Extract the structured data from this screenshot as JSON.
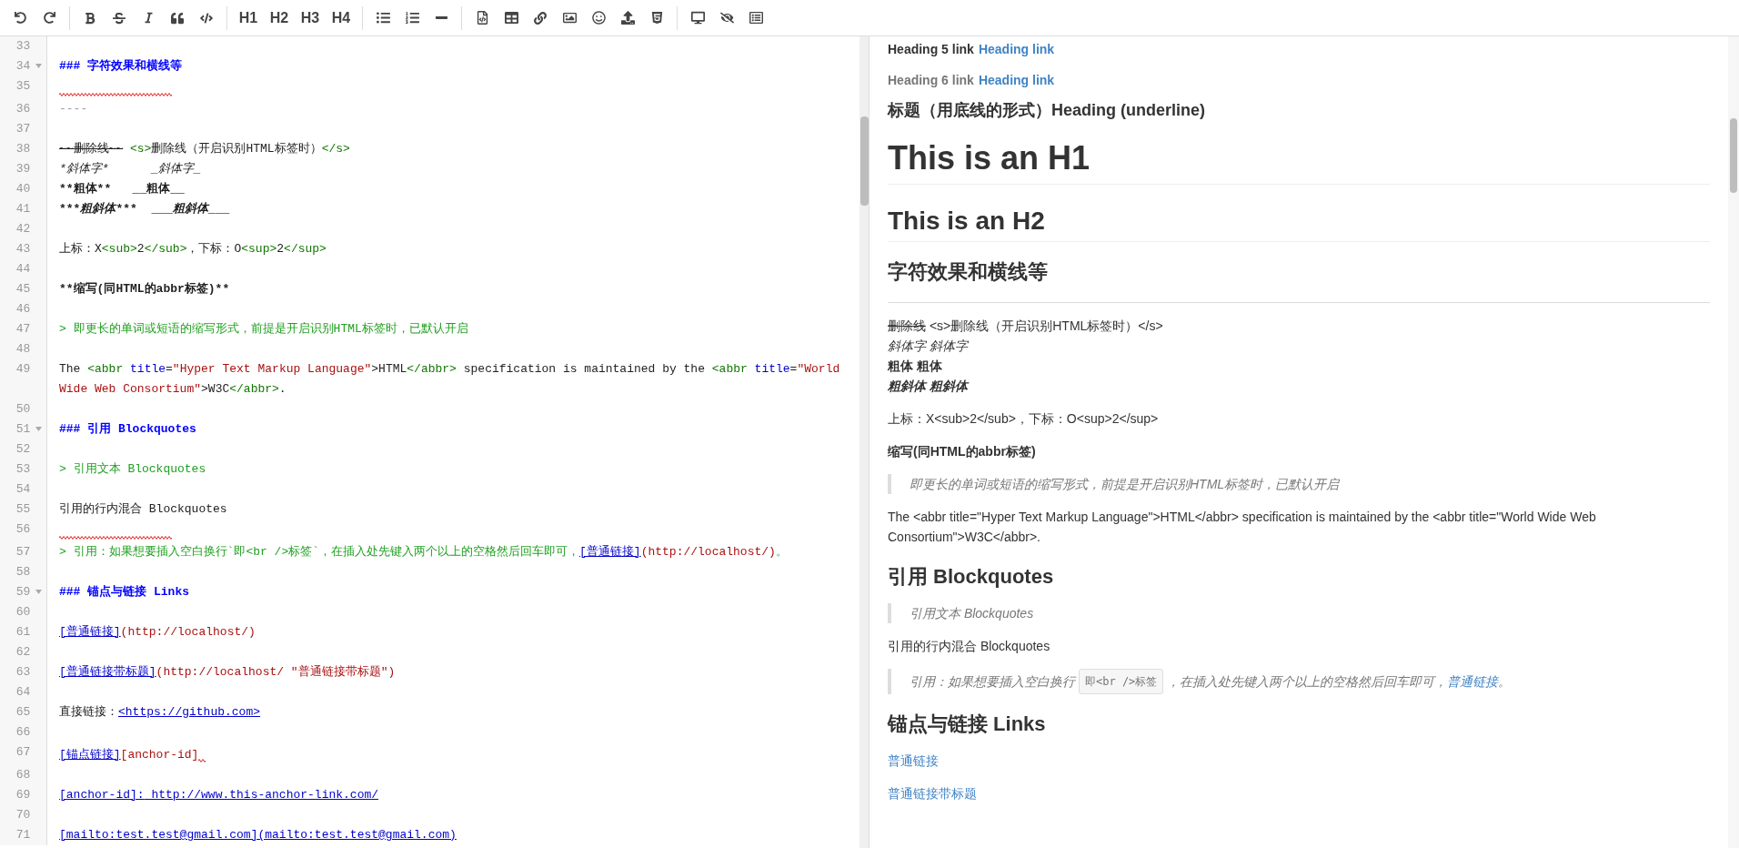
{
  "toolbar": {
    "headings": [
      "H1",
      "H2",
      "H3",
      "H4"
    ]
  },
  "editor": {
    "lines": [
      {
        "number": "33",
        "foldable": false,
        "squiggle": false
      },
      {
        "number": "34",
        "foldable": true,
        "squiggle": false,
        "segments": [
          {
            "text": "### 字符效果和横线等",
            "kind": "heading"
          }
        ]
      },
      {
        "number": "35",
        "foldable": false,
        "squiggle": true
      },
      {
        "number": "36",
        "foldable": false,
        "squiggle": false,
        "segments": [
          {
            "text": "----",
            "kind": "hr"
          }
        ]
      },
      {
        "number": "37",
        "foldable": false,
        "squiggle": false
      },
      {
        "number": "38",
        "foldable": false,
        "squiggle": false,
        "segments": [
          {
            "text": "~~删除线~~",
            "kind": "strike"
          },
          {
            "text": " <s>",
            "kind": "tag"
          },
          {
            "text": "删除线（开启识别HTML标签时）",
            "kind": "plain"
          },
          {
            "text": "</s>",
            "kind": "tag"
          }
        ]
      },
      {
        "number": "39",
        "foldable": false,
        "squiggle": false,
        "segments": [
          {
            "text": "*斜体字*      _斜体字_",
            "kind": "italic"
          }
        ]
      },
      {
        "number": "40",
        "foldable": false,
        "squiggle": false,
        "segments": [
          {
            "text": "**粗体**   __粗体__",
            "kind": "bold"
          }
        ]
      },
      {
        "number": "41",
        "foldable": false,
        "squiggle": false,
        "segments": [
          {
            "text": "***",
            "kind": "bold"
          },
          {
            "text": "粗斜体",
            "kind": "bolditalic"
          },
          {
            "text": "***  ___",
            "kind": "bold"
          },
          {
            "text": "粗斜体",
            "kind": "bolditalic"
          },
          {
            "text": "___",
            "kind": "bold"
          }
        ]
      },
      {
        "number": "42",
        "foldable": false,
        "squiggle": false
      },
      {
        "number": "43",
        "foldable": false,
        "squiggle": false,
        "segments": [
          {
            "text": "上标：X",
            "kind": "plain"
          },
          {
            "text": "<sub>",
            "kind": "tag"
          },
          {
            "text": "2",
            "kind": "plain"
          },
          {
            "text": "</sub>",
            "kind": "tag"
          },
          {
            "text": "，下标：O",
            "kind": "plain"
          },
          {
            "text": "<sup>",
            "kind": "tag"
          },
          {
            "text": "2",
            "kind": "plain"
          },
          {
            "text": "</sup>",
            "kind": "tag"
          }
        ]
      },
      {
        "number": "44",
        "foldable": false,
        "squiggle": false
      },
      {
        "number": "45",
        "foldable": false,
        "squiggle": false,
        "segments": [
          {
            "text": "**缩写(同HTML的abbr标签)**",
            "kind": "bold"
          }
        ]
      },
      {
        "number": "46",
        "foldable": false,
        "squiggle": false
      },
      {
        "number": "47",
        "foldable": false,
        "squiggle": false,
        "segments": [
          {
            "text": "> 即更长的单词或短语的缩写形式，前提是开启识别HTML标签时，已默认开启",
            "kind": "quote"
          }
        ]
      },
      {
        "number": "48",
        "foldable": false,
        "squiggle": false
      },
      {
        "number": "49",
        "foldable": false,
        "squiggle": false,
        "segments": [
          {
            "text": "The ",
            "kind": "plain"
          },
          {
            "text": "<abbr ",
            "kind": "tag"
          },
          {
            "text": "title",
            "kind": "attr"
          },
          {
            "text": "=",
            "kind": "plain"
          },
          {
            "text": "\"Hyper Text Markup Language\"",
            "kind": "string"
          },
          {
            "text": ">HTML",
            "kind": "plain"
          },
          {
            "text": "</abbr>",
            "kind": "tag"
          },
          {
            "text": " specification is maintained by the ",
            "kind": "plain"
          },
          {
            "text": "<abbr ",
            "kind": "tag"
          },
          {
            "text": "title",
            "kind": "attr"
          },
          {
            "text": "=",
            "kind": "plain"
          },
          {
            "text": "\"World Wide Web Consortium\"",
            "kind": "string"
          },
          {
            "text": ">W3C",
            "kind": "plain"
          },
          {
            "text": "</abbr>",
            "kind": "tag"
          },
          {
            "text": ".",
            "kind": "plain"
          }
        ]
      },
      {
        "number": "50",
        "foldable": false,
        "squiggle": false
      },
      {
        "number": "51",
        "foldable": true,
        "squiggle": false,
        "segments": [
          {
            "text": "### 引用 Blockquotes",
            "kind": "heading"
          }
        ]
      },
      {
        "number": "52",
        "foldable": false,
        "squiggle": false
      },
      {
        "number": "53",
        "foldable": false,
        "squiggle": false,
        "segments": [
          {
            "text": "> 引用文本 Blockquotes",
            "kind": "quote"
          }
        ]
      },
      {
        "number": "54",
        "foldable": false,
        "squiggle": false
      },
      {
        "number": "55",
        "foldable": false,
        "squiggle": false,
        "segments": [
          {
            "text": "引用的行内混合 Blockquotes",
            "kind": "plain"
          }
        ]
      },
      {
        "number": "56",
        "foldable": false,
        "squiggle": true
      },
      {
        "number": "57",
        "foldable": false,
        "squiggle": false,
        "segments": [
          {
            "text": "> 引用：如果想要插入空白换行`即<br />标签`，在插入处先键入两个以上的空格然后回车即可，",
            "kind": "quote"
          },
          {
            "text": "[普通链接]",
            "kind": "linktext"
          },
          {
            "text": "(http://localhost/)",
            "kind": "url"
          },
          {
            "text": "。",
            "kind": "quote"
          }
        ]
      },
      {
        "number": "58",
        "foldable": false,
        "squiggle": false
      },
      {
        "number": "59",
        "foldable": true,
        "squiggle": false,
        "segments": [
          {
            "text": "### 锚点与链接 Links",
            "kind": "heading"
          }
        ]
      },
      {
        "number": "60",
        "foldable": false,
        "squiggle": false
      },
      {
        "number": "61",
        "foldable": false,
        "squiggle": false,
        "segments": [
          {
            "text": "[普通链接]",
            "kind": "linktext"
          },
          {
            "text": "(http://localhost/)",
            "kind": "url"
          }
        ]
      },
      {
        "number": "62",
        "foldable": false,
        "squiggle": false
      },
      {
        "number": "63",
        "foldable": false,
        "squiggle": false,
        "segments": [
          {
            "text": "[普通链接带标题]",
            "kind": "linktext"
          },
          {
            "text": "(http://localhost/ \"普通链接带标题\")",
            "kind": "url"
          }
        ]
      },
      {
        "number": "64",
        "foldable": false,
        "squiggle": false
      },
      {
        "number": "65",
        "foldable": false,
        "squiggle": false,
        "segments": [
          {
            "text": "直接链接：",
            "kind": "plain"
          },
          {
            "text": "<https://github.com>",
            "kind": "linktext"
          }
        ]
      },
      {
        "number": "66",
        "foldable": false,
        "squiggle": false
      },
      {
        "number": "67",
        "foldable": false,
        "squiggle": true,
        "segments": [
          {
            "text": "[锚点链接]",
            "kind": "linktext"
          },
          {
            "text": "[anchor-id]",
            "kind": "url"
          }
        ]
      },
      {
        "number": "68",
        "foldable": false,
        "squiggle": false
      },
      {
        "number": "69",
        "foldable": false,
        "squiggle": false,
        "segments": [
          {
            "text": "[anchor-id]:",
            "kind": "linktext"
          },
          {
            "text": " http://www.this-anchor-link.com/",
            "kind": "linktext"
          }
        ]
      },
      {
        "number": "70",
        "foldable": false,
        "squiggle": false
      },
      {
        "number": "71",
        "foldable": false,
        "squiggle": false,
        "segments": [
          {
            "text": "[mailto:test.test@gmail.com](mailto:test.test@gmail.com)",
            "kind": "linktext"
          }
        ]
      }
    ]
  },
  "preview": {
    "blocks": [
      {
        "kind": "h5",
        "lines": [
          {
            "segments": [
              {
                "text": "Heading 5 link",
                "kind": "plain"
              },
              {
                "text": "Heading link",
                "kind": "link"
              }
            ]
          }
        ]
      },
      {
        "kind": "h6",
        "lines": [
          {
            "segments": [
              {
                "text": "Heading 6 link",
                "kind": "plain"
              },
              {
                "text": "Heading link",
                "kind": "link"
              }
            ]
          }
        ]
      },
      {
        "kind": "h4",
        "lines": [
          {
            "segments": [
              {
                "text": "标题（用底线的形式）Heading (underline)",
                "kind": "plain"
              }
            ]
          }
        ]
      },
      {
        "kind": "h1",
        "lines": [
          {
            "segments": [
              {
                "text": "This is an H1",
                "kind": "plain"
              }
            ]
          }
        ]
      },
      {
        "kind": "h2",
        "lines": [
          {
            "segments": [
              {
                "text": "This is an H2",
                "kind": "plain"
              }
            ]
          }
        ]
      },
      {
        "kind": "h3",
        "lines": [
          {
            "segments": [
              {
                "text": "字符效果和横线等",
                "kind": "plain"
              }
            ]
          }
        ]
      },
      {
        "kind": "hr"
      },
      {
        "kind": "p",
        "lines": [
          {
            "segments": [
              {
                "text": "删除线",
                "kind": "strike"
              },
              {
                "text": " <s>删除线（开启识别HTML标签时）</s>",
                "kind": "plain"
              }
            ]
          },
          {
            "segments": [
              {
                "text": "斜体字 斜体字",
                "kind": "italic"
              }
            ]
          },
          {
            "segments": [
              {
                "text": "粗体 粗体",
                "kind": "bold"
              }
            ]
          },
          {
            "segments": [
              {
                "text": "粗斜体 粗斜体",
                "kind": "bolditalic"
              }
            ]
          }
        ]
      },
      {
        "kind": "p",
        "lines": [
          {
            "segments": [
              {
                "text": "上标：X<sub>2</sub>，下标：O<sup>2</sup>",
                "kind": "plain"
              }
            ]
          }
        ]
      },
      {
        "kind": "p",
        "lines": [
          {
            "segments": [
              {
                "text": "缩写(同HTML的abbr标签)",
                "kind": "bold"
              }
            ]
          }
        ]
      },
      {
        "kind": "quote",
        "lines": [
          {
            "segments": [
              {
                "text": "即更长的单词或短语的缩写形式，前提是开启识别HTML标签时，已默认开启",
                "kind": "plain"
              }
            ]
          }
        ]
      },
      {
        "kind": "p",
        "lines": [
          {
            "segments": [
              {
                "text": "The <abbr title=\"Hyper Text Markup Language\">HTML</abbr> specification is maintained by the <abbr title=\"World Wide Web Consortium\">W3C</abbr>.",
                "kind": "plain"
              }
            ]
          }
        ]
      },
      {
        "kind": "h3",
        "lines": [
          {
            "segments": [
              {
                "text": "引用 Blockquotes",
                "kind": "plain"
              }
            ]
          }
        ]
      },
      {
        "kind": "quote",
        "lines": [
          {
            "segments": [
              {
                "text": "引用文本 Blockquotes",
                "kind": "plain"
              }
            ]
          }
        ]
      },
      {
        "kind": "p",
        "lines": [
          {
            "segments": [
              {
                "text": "引用的行内混合 Blockquotes",
                "kind": "plain"
              }
            ]
          }
        ]
      },
      {
        "kind": "quote",
        "lines": [
          {
            "segments": [
              {
                "text": "引用：如果想要插入空白换行",
                "kind": "plain"
              },
              {
                "text": "即<br />标签",
                "kind": "code"
              },
              {
                "text": "，在插入处先键入两个以上的空格然后回车即可，",
                "kind": "plain"
              },
              {
                "text": "普通链接",
                "kind": "link"
              },
              {
                "text": "。",
                "kind": "plain"
              }
            ]
          }
        ]
      },
      {
        "kind": "h3",
        "lines": [
          {
            "segments": [
              {
                "text": "锚点与链接 Links",
                "kind": "plain"
              }
            ]
          }
        ]
      },
      {
        "kind": "p",
        "lines": [
          {
            "segments": [
              {
                "text": "普通链接",
                "kind": "link"
              }
            ]
          }
        ]
      },
      {
        "kind": "p",
        "lines": [
          {
            "segments": [
              {
                "text": "普通链接带标题",
                "kind": "link"
              }
            ]
          }
        ]
      }
    ]
  }
}
